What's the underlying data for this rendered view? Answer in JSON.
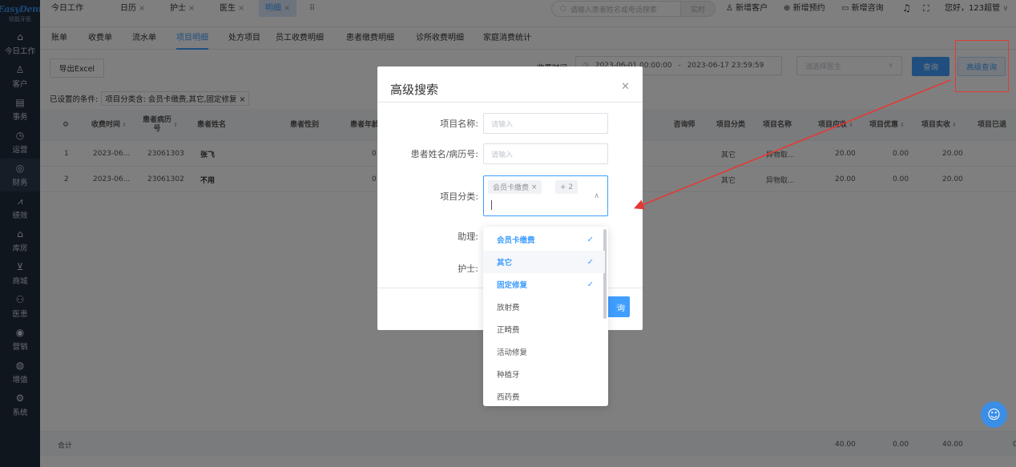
{
  "logo": {
    "brand": "EasyDent",
    "sub": "轻能牙医"
  },
  "sidebar": [
    {
      "label": "今日工作",
      "icon": "⌂",
      "icon_name": "home-icon"
    },
    {
      "label": "客户",
      "icon": "♙",
      "icon_name": "user-icon"
    },
    {
      "label": "事务",
      "icon": "▤",
      "icon_name": "task-icon"
    },
    {
      "label": "运营",
      "icon": "◷",
      "icon_name": "clock-icon"
    },
    {
      "label": "财务",
      "icon": "◎",
      "icon_name": "finance-icon"
    },
    {
      "label": "绩效",
      "icon": "⩘",
      "icon_name": "chart-icon"
    },
    {
      "label": "库房",
      "icon": "⌂",
      "icon_name": "warehouse-icon"
    },
    {
      "label": "商城",
      "icon": "⊻",
      "icon_name": "cart-icon"
    },
    {
      "label": "医患",
      "icon": "⚇",
      "icon_name": "doctor-patient-icon"
    },
    {
      "label": "营销",
      "icon": "◉",
      "icon_name": "marketing-icon"
    },
    {
      "label": "增值",
      "icon": "◍",
      "icon_name": "value-added-icon"
    },
    {
      "label": "系统",
      "icon": "⚙",
      "icon_name": "gear-icon"
    }
  ],
  "top_tabs": [
    {
      "label": "今日工作",
      "closable": false
    },
    {
      "label": "日历",
      "closable": true
    },
    {
      "label": "护士",
      "closable": true
    },
    {
      "label": "医生",
      "closable": true
    },
    {
      "label": "明细",
      "closable": true,
      "active": true
    }
  ],
  "top_search": {
    "placeholder": "请输入患者姓名或电话搜索",
    "button": "实时"
  },
  "top_actions": {
    "new_customer": "新增客户",
    "new_appointment": "新增预约",
    "new_consult": "新增咨询",
    "greeting": "您好，123超管"
  },
  "subnav": [
    "账单",
    "收费单",
    "流水单",
    "项目明细",
    "处方项目",
    "员工收费明细",
    "患者缴费明细",
    "诊所收费明细",
    "家庭消费统计"
  ],
  "toolbar": {
    "export_label": "导出Excel",
    "charge_time_label": "收费时间:",
    "date_start": "2023-06-01 00:00:00",
    "date_sep": "-",
    "date_end": "2023-06-17 23:59:59",
    "doctor_placeholder": "请选择医生",
    "query_label": "查询",
    "advanced_label": "高级查询"
  },
  "conditions": {
    "label": "已设置的条件:",
    "tag": "项目分类含: 会员卡缴费,其它,固定修复"
  },
  "table": {
    "headers_left": [
      "收费时间",
      "患者病历号",
      "患者姓名",
      "患者性别",
      "患者年龄"
    ],
    "headers_right": [
      "咨询师",
      "项目分类",
      "项目名称",
      "项目应收",
      "项目优惠",
      "项目实收",
      "项目已退"
    ],
    "rows": [
      {
        "idx": "1",
        "time": "2023-06...",
        "record": "23061303",
        "name": "张飞",
        "age": "0",
        "category": "其它",
        "item": "异物取...",
        "due": "20.00",
        "discount": "0.00",
        "paid": "20.00"
      },
      {
        "idx": "2",
        "time": "2023-06...",
        "record": "23061302",
        "name": "不用",
        "age": "0",
        "category": "其它",
        "item": "异物取...",
        "due": "20.00",
        "discount": "0.00",
        "paid": "20.00"
      }
    ],
    "footer": {
      "label": "合计",
      "due": "40.00",
      "discount": "0.00",
      "paid": "40.00",
      "refund": "0"
    }
  },
  "dialog": {
    "title": "高级搜索",
    "item_name_label": "项目名称:",
    "item_name_placeholder": "请输入",
    "patient_label": "患者姓名/病历号:",
    "patient_placeholder": "请输入",
    "category_label": "项目分类:",
    "category_chip": "会员卡缴费",
    "category_more": "+ 2",
    "assistant_label": "助理:",
    "nurse_label": "护士:",
    "submit_partial": "查询"
  },
  "dropdown": [
    {
      "label": "会员卡缴费",
      "selected": true
    },
    {
      "label": "其它",
      "selected": true,
      "hover": true
    },
    {
      "label": "固定修复",
      "selected": true
    },
    {
      "label": "放射费",
      "selected": false
    },
    {
      "label": "正畸费",
      "selected": false
    },
    {
      "label": "活动修复",
      "selected": false
    },
    {
      "label": "种植牙",
      "selected": false
    },
    {
      "label": "西药费",
      "selected": false
    }
  ],
  "colors": {
    "primary": "#409eff",
    "sidebar": "#1f2d3d",
    "annotation": "#e53935"
  }
}
